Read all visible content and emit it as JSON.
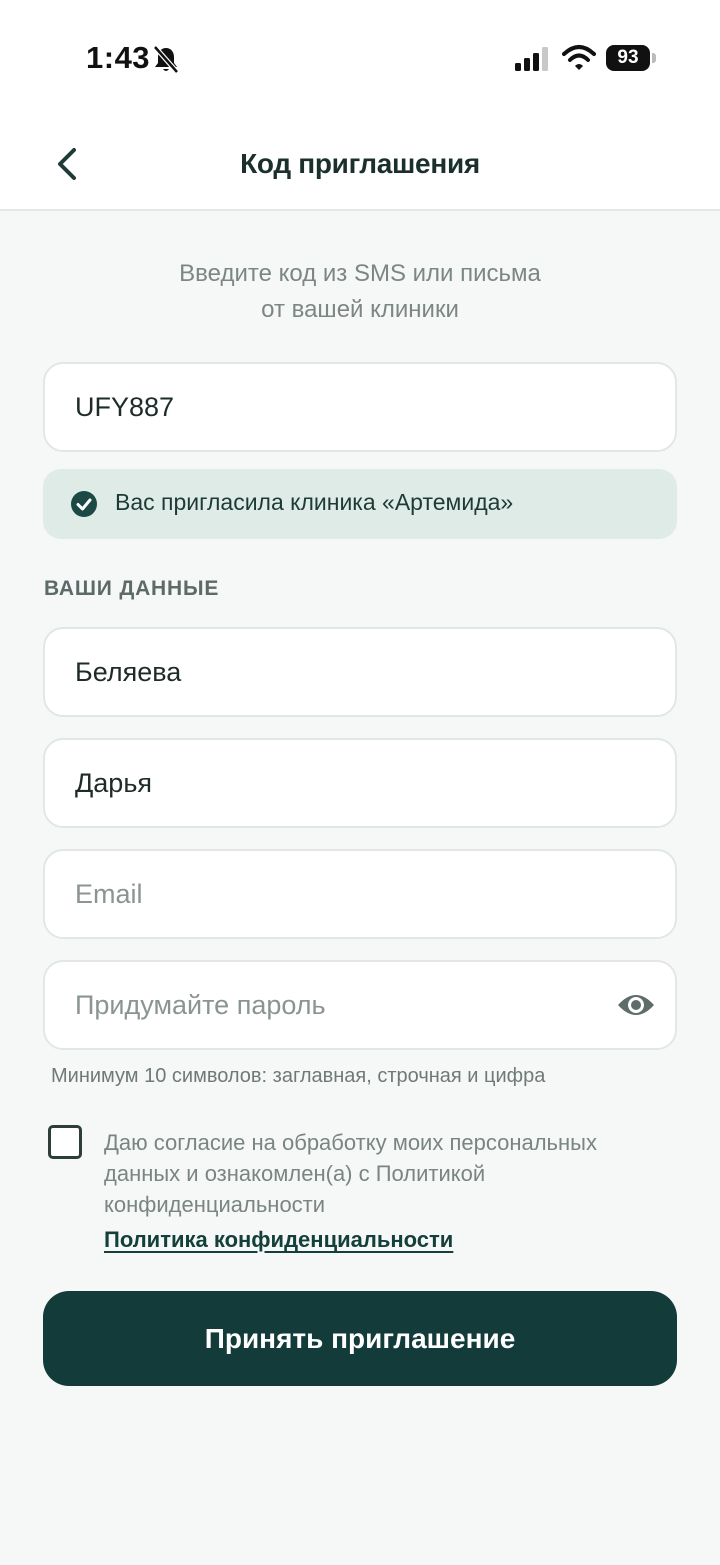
{
  "status_bar": {
    "time": "1:43",
    "battery": "93",
    "icons": [
      "bell-slash-icon",
      "cellular-signal-icon",
      "wifi-icon",
      "battery-icon"
    ]
  },
  "nav": {
    "title": "Код приглашения",
    "back_icon": "chevron-left-icon"
  },
  "subtitle": {
    "line1": "Введите код из SMS или письма",
    "line2": "от вашей клиники"
  },
  "code_field": {
    "value": "UFY887",
    "placeholder": ""
  },
  "invite_banner": {
    "icon": "check-circle-icon",
    "text": "Вас пригласила клиника «Артемида»"
  },
  "section_label": "ВАШИ ДАННЫЕ",
  "fields": {
    "last_name": {
      "value": "Беляева",
      "placeholder": ""
    },
    "first_name": {
      "value": "Дарья",
      "placeholder": ""
    },
    "email": {
      "value": "",
      "placeholder": "Email"
    },
    "password": {
      "value": "",
      "placeholder": "Придумайте пароль",
      "icon": "eye-icon"
    }
  },
  "password_hint": "Минимум 10 символов: заглавная, строчная и цифра",
  "consent": {
    "checked": false,
    "text": "Даю согласие на обработку моих персональных данных и ознакомлен(а) с Политикой конфиденциальности",
    "link": "Политика конфиденциальности"
  },
  "accept_button": "Принять приглашение",
  "colors": {
    "primary": "#123b3a",
    "banner_bg": "#deebe7",
    "page_bg": "#f6f8f7"
  }
}
